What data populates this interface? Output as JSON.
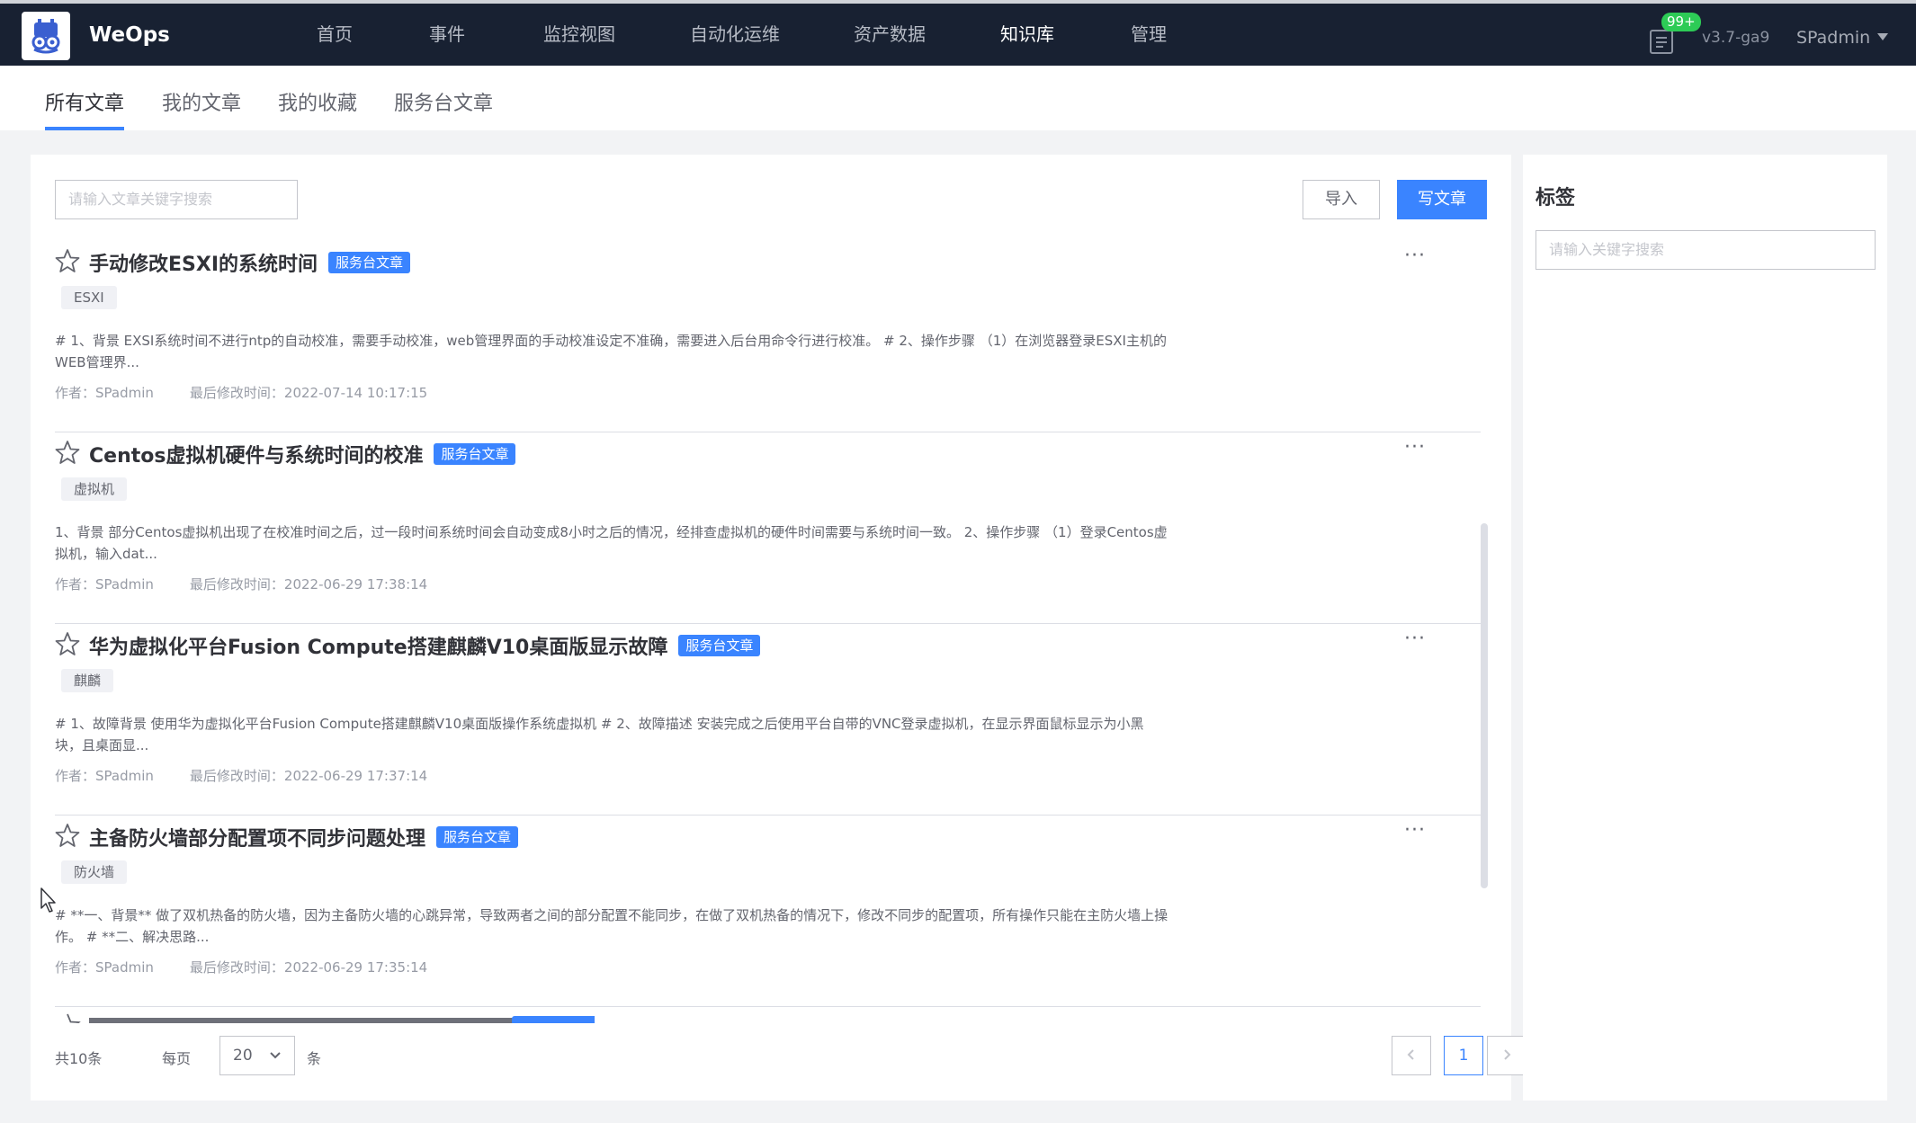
{
  "app": {
    "name": "WeOps",
    "version": "v3.7-ga9",
    "user": "SPadmin",
    "notification_count": "99+"
  },
  "nav": [
    {
      "label": "首页"
    },
    {
      "label": "事件"
    },
    {
      "label": "监控视图"
    },
    {
      "label": "自动化运维"
    },
    {
      "label": "资产数据"
    },
    {
      "label": "知识库"
    },
    {
      "label": "管理"
    }
  ],
  "subtabs": [
    {
      "label": "所有文章"
    },
    {
      "label": "我的文章"
    },
    {
      "label": "我的收藏"
    },
    {
      "label": "服务台文章"
    }
  ],
  "toolbar": {
    "search_placeholder": "请输入文章关键字搜索",
    "import_label": "导入",
    "write_label": "写文章"
  },
  "articles": [
    {
      "title": "手动修改ESXI的系统时间",
      "badge": "服务台文章",
      "tag": "ESXI",
      "summary": "# 1、背景 EXSI系统时间不进行ntp的自动校准，需要手动校准，web管理界面的手动校准设定不准确，需要进入后台用命令行进行校准。 # 2、操作步骤 （1）在浏览器登录ESXI主机的WEB管理界...",
      "author": "作者：SPadmin",
      "modified": "最后修改时间：2022-07-14 10:17:15"
    },
    {
      "title": "Centos虚拟机硬件与系统时间的校准",
      "badge": "服务台文章",
      "tag": "虚拟机",
      "summary": "1、背景 部分Centos虚拟机出现了在校准时间之后，过一段时间系统时间会自动变成8小时之后的情况，经排查虚拟机的硬件时间需要与系统时间一致。 2、操作步骤 （1）登录Centos虚拟机，输入dat...",
      "author": "作者：SPadmin",
      "modified": "最后修改时间：2022-06-29 17:38:14"
    },
    {
      "title": "华为虚拟化平台Fusion Compute搭建麒麟V10桌面版显示故障",
      "badge": "服务台文章",
      "tag": "麒麟",
      "summary": "# 1、故障背景 使用华为虚拟化平台Fusion Compute搭建麒麟V10桌面版操作系统虚拟机 # 2、故障描述 安装完成之后使用平台自带的VNC登录虚拟机，在显示界面鼠标显示为小黑块，且桌面显...",
      "author": "作者：SPadmin",
      "modified": "最后修改时间：2022-06-29 17:37:14"
    },
    {
      "title": "主备防火墙部分配置项不同步问题处理",
      "badge": "服务台文章",
      "tag": "防火墙",
      "summary": "# **一、背景** 做了双机热备的防火墙，因为主备防火墙的心跳异常，导致两者之间的部分配置不能同步，在做了双机热备的情况下，修改不同步的配置项，所有操作只能在主防火墙上操作。 # **二、解决思路...",
      "author": "作者：SPadmin",
      "modified": "最后修改时间：2022-06-29 17:35:14"
    }
  ],
  "pagination": {
    "total": "共10条",
    "per_page_label": "每页",
    "per_page_value": "20",
    "unit": "条",
    "current_page": "1"
  },
  "sidebar": {
    "title": "标签",
    "search_placeholder": "请输入关键字搜索"
  },
  "colors": {
    "nav_bg": "#182132",
    "accent": "#3a84ff",
    "badge_green": "#2dcb56"
  }
}
